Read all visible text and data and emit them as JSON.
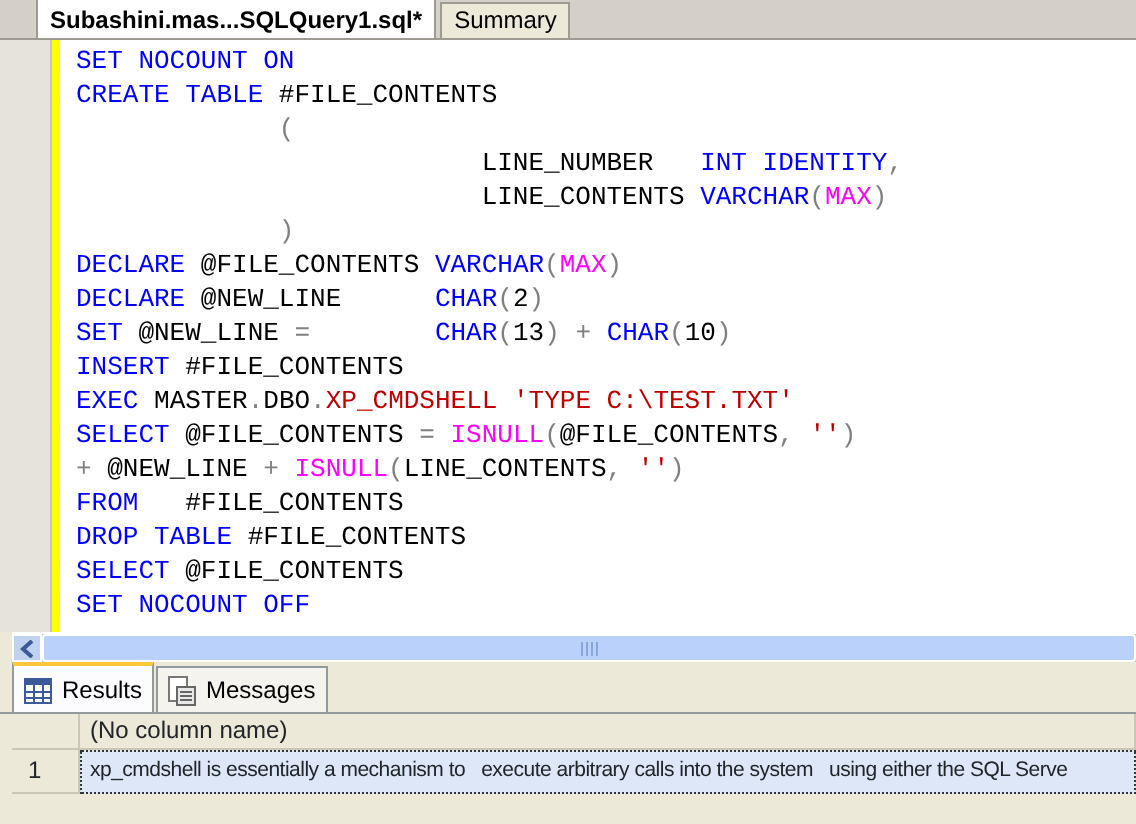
{
  "editor_tabs": [
    {
      "label": "Subashini.mas...SQLQuery1.sql*",
      "selected": true
    },
    {
      "label": "Summary",
      "selected": false
    }
  ],
  "code_lines": [
    [
      {
        "text": "SET NOCOUNT ON",
        "kind": "keyword"
      }
    ],
    [
      {
        "text": "CREATE TABLE",
        "kind": "keyword"
      },
      {
        "text": " #FILE_CONTENTS",
        "kind": "plain"
      }
    ],
    [
      {
        "text": "             (",
        "kind": "operator"
      }
    ],
    [
      {
        "text": "                          LINE_NUMBER   ",
        "kind": "plain"
      },
      {
        "text": "INT IDENTITY",
        "kind": "keyword"
      },
      {
        "text": ",",
        "kind": "operator"
      }
    ],
    [
      {
        "text": "                          LINE_CONTENTS ",
        "kind": "plain"
      },
      {
        "text": "VARCHAR",
        "kind": "keyword"
      },
      {
        "text": "(",
        "kind": "operator"
      },
      {
        "text": "MAX",
        "kind": "function"
      },
      {
        "text": ")",
        "kind": "operator"
      }
    ],
    [
      {
        "text": "             )",
        "kind": "operator"
      }
    ],
    [
      {
        "text": "DECLARE",
        "kind": "keyword"
      },
      {
        "text": " @FILE_CONTENTS ",
        "kind": "plain"
      },
      {
        "text": "VARCHAR",
        "kind": "keyword"
      },
      {
        "text": "(",
        "kind": "operator"
      },
      {
        "text": "MAX",
        "kind": "function"
      },
      {
        "text": ")",
        "kind": "operator"
      }
    ],
    [
      {
        "text": "DECLARE",
        "kind": "keyword"
      },
      {
        "text": " @NEW_LINE      ",
        "kind": "plain"
      },
      {
        "text": "CHAR",
        "kind": "keyword"
      },
      {
        "text": "(",
        "kind": "operator"
      },
      {
        "text": "2",
        "kind": "plain"
      },
      {
        "text": ")",
        "kind": "operator"
      }
    ],
    [
      {
        "text": "SET",
        "kind": "keyword"
      },
      {
        "text": " @NEW_LINE ",
        "kind": "plain"
      },
      {
        "text": "=        ",
        "kind": "operator"
      },
      {
        "text": "CHAR",
        "kind": "keyword"
      },
      {
        "text": "(",
        "kind": "operator"
      },
      {
        "text": "13",
        "kind": "plain"
      },
      {
        "text": ") + ",
        "kind": "operator"
      },
      {
        "text": "CHAR",
        "kind": "keyword"
      },
      {
        "text": "(",
        "kind": "operator"
      },
      {
        "text": "10",
        "kind": "plain"
      },
      {
        "text": ")",
        "kind": "operator"
      }
    ],
    [
      {
        "text": "INSERT",
        "kind": "keyword"
      },
      {
        "text": " #FILE_CONTENTS",
        "kind": "plain"
      }
    ],
    [
      {
        "text": "EXEC",
        "kind": "keyword"
      },
      {
        "text": " MASTER",
        "kind": "plain"
      },
      {
        "text": ".",
        "kind": "operator"
      },
      {
        "text": "DBO",
        "kind": "plain"
      },
      {
        "text": ".",
        "kind": "operator"
      },
      {
        "text": "XP_CMDSHELL",
        "kind": "system"
      },
      {
        "text": " 'TYPE C:\\TEST.TXT'",
        "kind": "string"
      }
    ],
    [
      {
        "text": "SELECT",
        "kind": "keyword"
      },
      {
        "text": " @FILE_CONTENTS ",
        "kind": "plain"
      },
      {
        "text": "= ",
        "kind": "operator"
      },
      {
        "text": "ISNULL",
        "kind": "function"
      },
      {
        "text": "(",
        "kind": "operator"
      },
      {
        "text": "@FILE_CONTENTS",
        "kind": "plain"
      },
      {
        "text": ", ",
        "kind": "operator"
      },
      {
        "text": "''",
        "kind": "string"
      },
      {
        "text": ")",
        "kind": "operator"
      }
    ],
    [
      {
        "text": "+ ",
        "kind": "operator"
      },
      {
        "text": "@NEW_LINE ",
        "kind": "plain"
      },
      {
        "text": "+ ",
        "kind": "operator"
      },
      {
        "text": "ISNULL",
        "kind": "function"
      },
      {
        "text": "(",
        "kind": "operator"
      },
      {
        "text": "LINE_CONTENTS",
        "kind": "plain"
      },
      {
        "text": ", ",
        "kind": "operator"
      },
      {
        "text": "''",
        "kind": "string"
      },
      {
        "text": ")",
        "kind": "operator"
      }
    ],
    [
      {
        "text": "FROM",
        "kind": "keyword"
      },
      {
        "text": "   #FILE_CONTENTS",
        "kind": "plain"
      }
    ],
    [
      {
        "text": "DROP TABLE",
        "kind": "keyword"
      },
      {
        "text": " #FILE_CONTENTS",
        "kind": "plain"
      }
    ],
    [
      {
        "text": "SELECT",
        "kind": "keyword"
      },
      {
        "text": " @FILE_CONTENTS",
        "kind": "plain"
      }
    ],
    [
      {
        "text": "SET NOCOUNT OFF",
        "kind": "keyword"
      }
    ]
  ],
  "result_tabs": [
    {
      "label": "Results",
      "kind": "grid",
      "selected": true
    },
    {
      "label": "Messages",
      "kind": "messages",
      "selected": false
    }
  ],
  "results": {
    "columns": [
      "(No column name)"
    ],
    "rows": [
      {
        "row_number": "1",
        "cells": [
          "xp_cmdshell is essentially a mechanism to   execute arbitrary calls into the system   using either the SQL Serve"
        ],
        "selected": true
      }
    ]
  }
}
